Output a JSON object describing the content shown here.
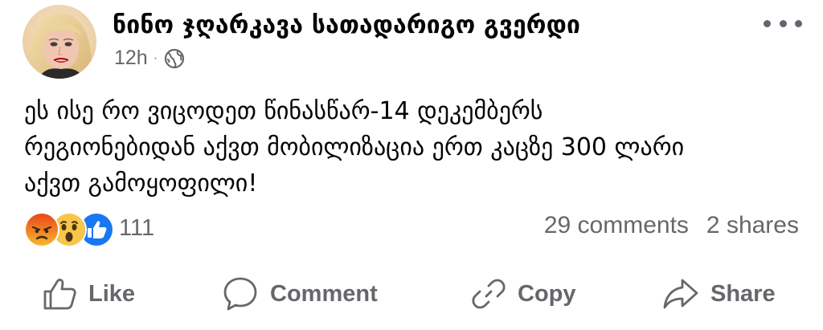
{
  "post": {
    "author": "ნინო ჯღარკავა სათადარიგო გვერდი",
    "timestamp": "12h",
    "separator": "·",
    "audience_icon": "globe-icon",
    "more_icon": "more-options-icon",
    "text_lines": [
      "ეს ისე რო ვიცოდეთ წინასწარ-14 დეკემბერს",
      "რეგიონებიდან აქვთ მობილიზაცია ერთ კაცზე 300 ლარი",
      "აქვთ გამოყოფილი!"
    ]
  },
  "reactions": {
    "icons": [
      "angry-reaction-icon",
      "wow-reaction-icon",
      "like-reaction-icon"
    ],
    "count": "111"
  },
  "stats": {
    "comments": "29 comments",
    "shares": "2 shares"
  },
  "actions": {
    "like": "Like",
    "comment": "Comment",
    "copy": "Copy",
    "share": "Share"
  },
  "colors": {
    "text_primary": "#050505",
    "text_secondary": "#65676b",
    "like_blue": "#1877f2",
    "reaction_yellow": "#f7c548",
    "angry_red": "#e9710f"
  }
}
